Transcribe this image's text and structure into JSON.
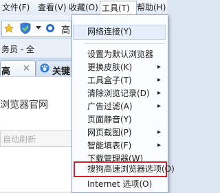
{
  "menubar": {
    "file": "文件(F)",
    "view": "查看(V)",
    "favorites": "收藏(O)",
    "tools": "工具(T)",
    "help": "帮助(H)"
  },
  "address": {
    "partial_text": "高"
  },
  "links_bar": {
    "partial_text": "务员 - 全"
  },
  "tabs": [
    {
      "label": "高",
      "close": "×"
    },
    {
      "label": "关键"
    }
  ],
  "page": {
    "heading": "浏览器官网",
    "search_placeholder": "自动刷新"
  },
  "tools_menu": {
    "items": [
      {
        "label": "网络连接(Y)"
      },
      {
        "label": "设置为默认浏览器"
      },
      {
        "label": "更换皮肤(K)",
        "has_submenu": true
      },
      {
        "label": "工具盒子(T)",
        "has_submenu": true
      },
      {
        "label": "清除浏览记录(D)",
        "has_submenu": true
      },
      {
        "label": "广告过滤(A)",
        "has_submenu": true
      },
      {
        "label": "页面静音(Y)"
      },
      {
        "label": "网页截图(P)",
        "has_submenu": true
      },
      {
        "label": "智能填表(F)",
        "has_submenu": true
      },
      {
        "label": "下载管理器(W)"
      },
      {
        "label": "搜狗高速浏览器选项(O)"
      },
      {
        "label": "Internet 选项(O)"
      }
    ],
    "submenu_glyph": "▸"
  },
  "colors": {
    "highlight_red": "#d4202a",
    "menu_bg": "#fbfcfe",
    "chrome_blue": "#dde7f3"
  }
}
